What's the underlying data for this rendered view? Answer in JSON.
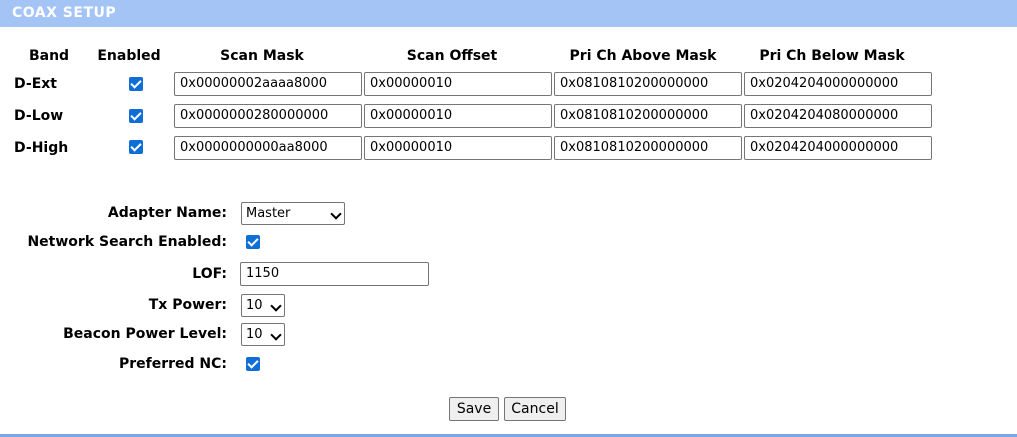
{
  "title": "COAX SETUP",
  "headers": {
    "band": "Band",
    "enabled": "Enabled",
    "scan_mask": "Scan Mask",
    "scan_offset": "Scan Offset",
    "pri_above": "Pri Ch Above Mask",
    "pri_below": "Pri Ch Below Mask"
  },
  "rows": [
    {
      "band": "D-Ext",
      "enabled": true,
      "scan_mask": "0x00000002aaaa8000",
      "scan_offset": "0x00000010",
      "pri_above": "0x0810810200000000",
      "pri_below": "0x0204204000000000"
    },
    {
      "band": "D-Low",
      "enabled": true,
      "scan_mask": "0x0000000280000000",
      "scan_offset": "0x00000010",
      "pri_above": "0x0810810200000000",
      "pri_below": "0x0204204080000000"
    },
    {
      "band": "D-High",
      "enabled": true,
      "scan_mask": "0x0000000000aa8000",
      "scan_offset": "0x00000010",
      "pri_above": "0x0810810200000000",
      "pri_below": "0x0204204000000000"
    }
  ],
  "form": {
    "adapter_name_label": "Adapter Name:",
    "adapter_name_value": "Master",
    "network_search_label": "Network Search Enabled:",
    "network_search_checked": true,
    "lof_label": "LOF:",
    "lof_value": "1150",
    "tx_power_label": "Tx Power:",
    "tx_power_value": "10",
    "beacon_power_label": "Beacon Power Level:",
    "beacon_power_value": "10",
    "preferred_nc_label": "Preferred NC:",
    "preferred_nc_checked": true
  },
  "buttons": {
    "save": "Save",
    "cancel": "Cancel"
  }
}
